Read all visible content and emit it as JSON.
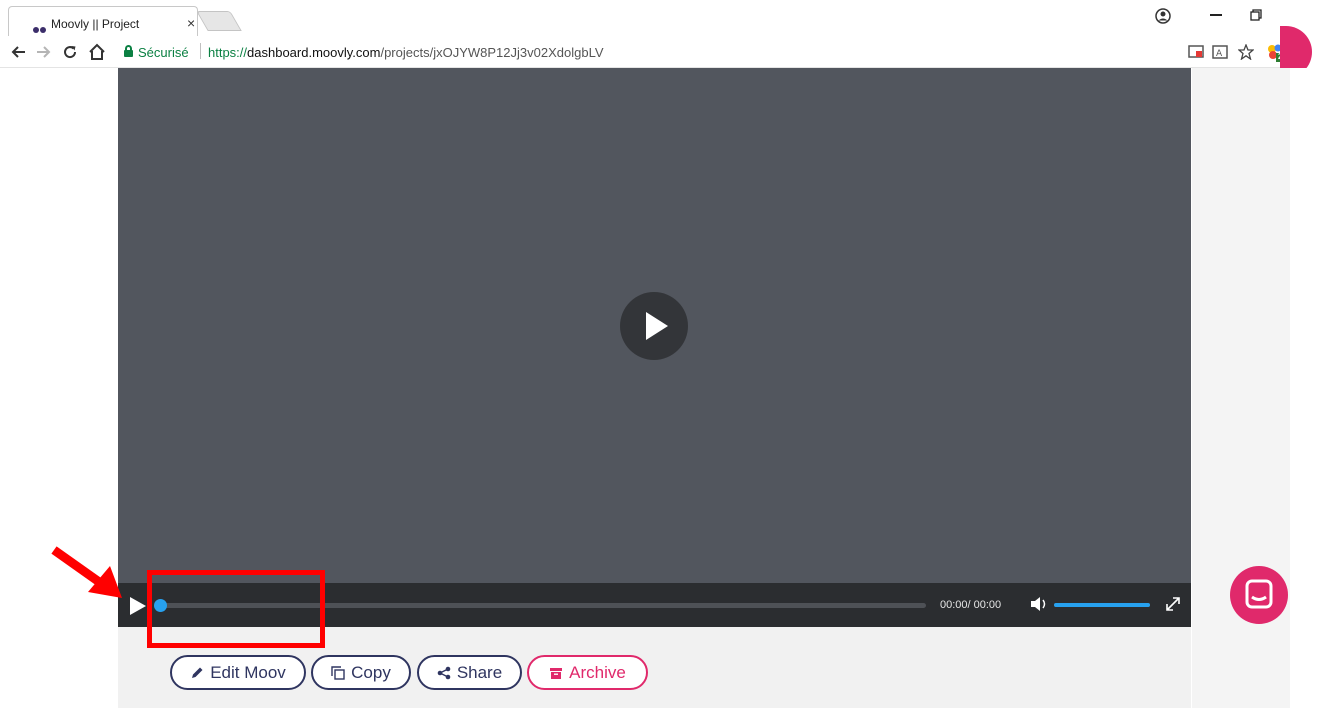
{
  "browser": {
    "tab_title": "Moovly || Project",
    "tab_close": "×",
    "secure_label": "Sécurisé",
    "url_scheme": "https://",
    "url_host": "dashboard.moovly.com",
    "url_path": "/projects/jxOJYW8P12Jj3v02XdolgbLV",
    "extension_badge": "2"
  },
  "player": {
    "time_label": "00:00/ 00:00",
    "progress": 0.0,
    "volume": 1.0
  },
  "actions": {
    "edit_label": "Edit Moov",
    "copy_label": "Copy",
    "share_label": "Share",
    "archive_label": "Archive"
  },
  "colors": {
    "brand_navy": "#2f3560",
    "brand_pink": "#e0296b",
    "player_accent": "#27a1ef",
    "annotation_red": "#ff0000"
  }
}
